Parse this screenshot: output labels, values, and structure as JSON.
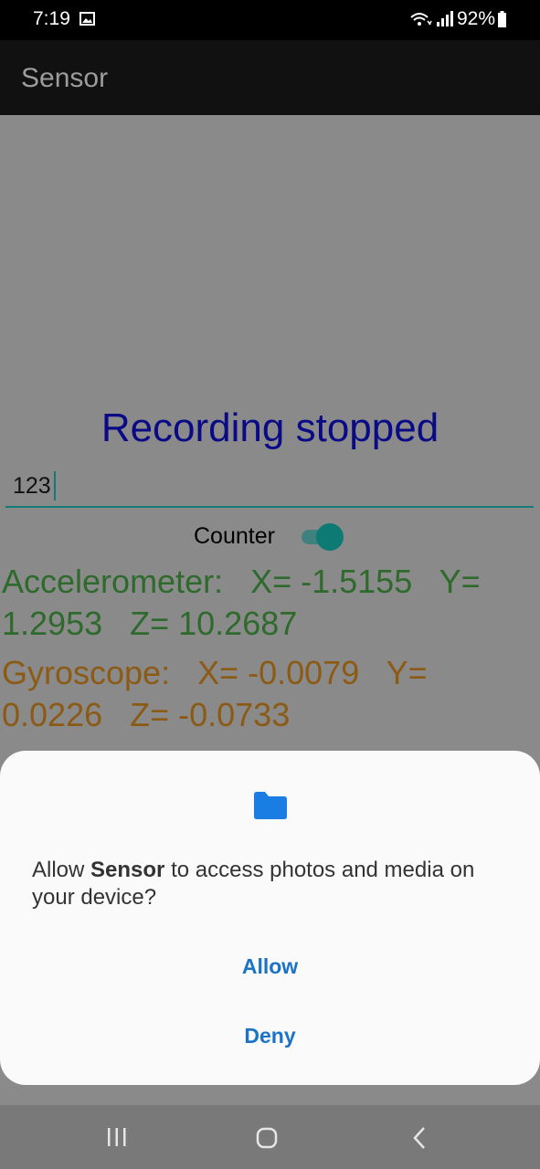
{
  "status_bar": {
    "time": "7:19",
    "battery": "92%"
  },
  "app_bar": {
    "title": "Sensor"
  },
  "main": {
    "recording_status": "Recording stopped",
    "counter_input": {
      "value": "123"
    },
    "counter_toggle": {
      "label": "Counter",
      "state": "on"
    },
    "accelerometer": {
      "text": "Accelerometer:   X= -1.5155   Y= 1.2953   Z= 10.2687"
    },
    "gyroscope": {
      "text": "Gyroscope:   X= -0.0079   Y= 0.0226   Z= -0.0733"
    }
  },
  "dialog": {
    "message_prefix": "Allow ",
    "app_name": "Sensor",
    "message_suffix": " to access photos and media on your device?",
    "allow_label": "Allow",
    "deny_label": "Deny",
    "icon": "folder-icon"
  },
  "nav_bar": {
    "icons": [
      "recent-apps-icon",
      "home-icon",
      "back-icon"
    ]
  },
  "colors": {
    "recording_status": "#0a0a86",
    "accelerometer": "#2f6a2d",
    "gyroscope": "#8b5b16",
    "accent": "#137a76",
    "dialog_button": "#1a73c7"
  }
}
